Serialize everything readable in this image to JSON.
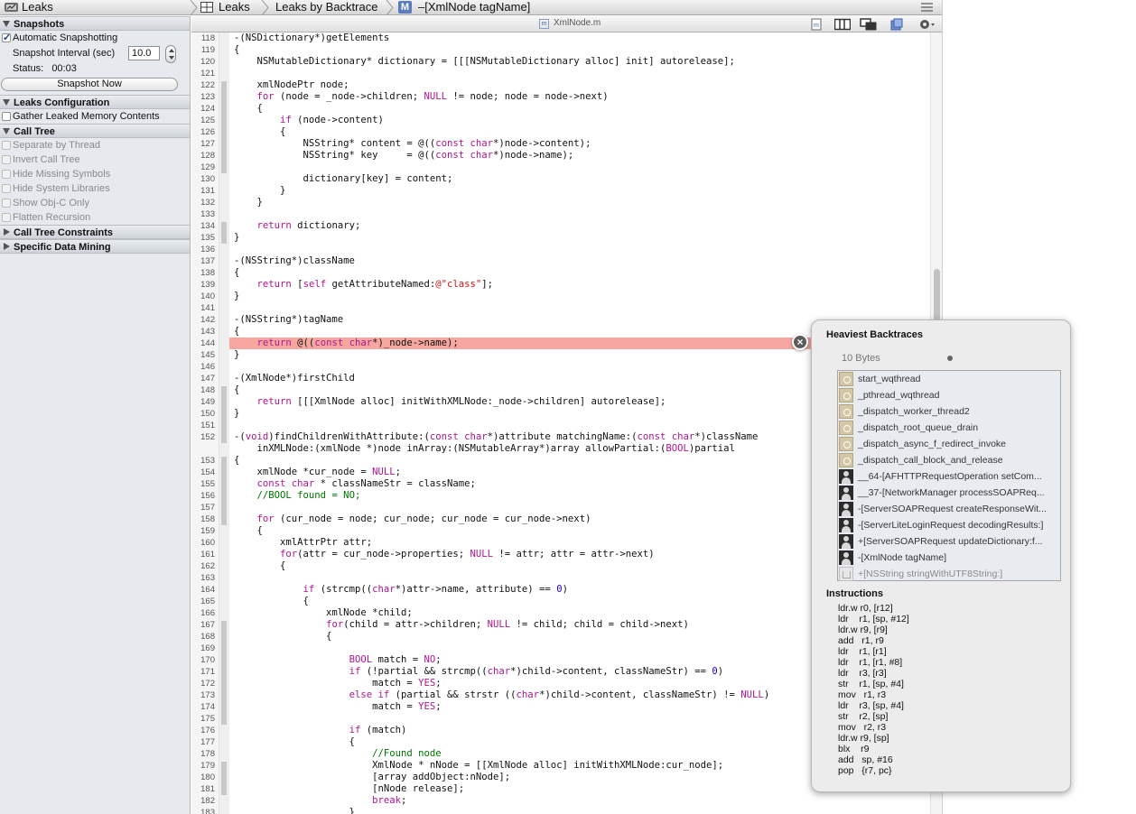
{
  "topbar": {
    "app_title": "Leaks",
    "crumb_1": "Leaks",
    "crumb_2": "Leaks by Backtrace",
    "crumb_3": "–[XmlNode tagName]",
    "badge": "M"
  },
  "left_panel": {
    "snapshots": {
      "header": "Snapshots",
      "auto_label": "Automatic Snapshotting",
      "interval_label": "Snapshot Interval (sec)",
      "interval_value": "10.0",
      "status_label": "Status:",
      "status_value": "00:03",
      "snapshot_button": "Snapshot Now"
    },
    "leaks_config": {
      "header": "Leaks Configuration",
      "gather_label": "Gather Leaked Memory Contents"
    },
    "call_tree": {
      "header": "Call Tree",
      "options": [
        "Separate by Thread",
        "Invert Call Tree",
        "Hide Missing Symbols",
        "Hide System Libraries",
        "Show Obj-C Only",
        "Flatten Recursion"
      ]
    },
    "constraints_header": "Call Tree Constraints",
    "data_mining_header": "Specific Data Mining"
  },
  "editor": {
    "file_name": "XmlNode.m",
    "file_badge": "m",
    "highlighted_line": 144,
    "lines": [
      {
        "n": "118",
        "html": "-(NSDictionary*)getElements"
      },
      {
        "n": "119",
        "html": "{"
      },
      {
        "n": "120",
        "html": "    NSMutableDictionary* dictionary = [[[NSMutableDictionary alloc] init] autorelease];"
      },
      {
        "n": "121",
        "html": ""
      },
      {
        "n": "122",
        "html": "    xmlNodePtr node;"
      },
      {
        "n": "123",
        "html": "    <span class=\"kw\">for</span> (node = _node->children; <span class=\"kw\">NULL</span> != node; node = node->next)"
      },
      {
        "n": "124",
        "html": "    {"
      },
      {
        "n": "125",
        "html": "        <span class=\"kw\">if</span> (node->content)"
      },
      {
        "n": "126",
        "html": "        {"
      },
      {
        "n": "127",
        "html": "            NSString* content = @((<span class=\"kw\">const char</span>*)node->content);"
      },
      {
        "n": "128",
        "html": "            NSString* key     = @((<span class=\"kw\">const char</span>*)node->name);"
      },
      {
        "n": "129",
        "html": ""
      },
      {
        "n": "130",
        "html": "            dictionary[key] = content;"
      },
      {
        "n": "131",
        "html": "        }"
      },
      {
        "n": "132",
        "html": "    }"
      },
      {
        "n": "133",
        "html": ""
      },
      {
        "n": "134",
        "html": "    <span class=\"kw\">return</span> dictionary;"
      },
      {
        "n": "135",
        "html": "}"
      },
      {
        "n": "136",
        "html": ""
      },
      {
        "n": "137",
        "html": "-(NSString*)className"
      },
      {
        "n": "138",
        "html": "{"
      },
      {
        "n": "139",
        "html": "    <span class=\"kw\">return</span> [<span class=\"kw\">self</span> getAttributeNamed:<span class=\"str\">@\"class\"</span>];"
      },
      {
        "n": "140",
        "html": "}"
      },
      {
        "n": "141",
        "html": ""
      },
      {
        "n": "142",
        "html": "-(NSString*)tagName"
      },
      {
        "n": "143",
        "html": "{"
      },
      {
        "n": "144",
        "html": "    <span class=\"kw\">return</span> @((<span class=\"kw\">const char</span>*)_node->name);"
      },
      {
        "n": "145",
        "html": "}"
      },
      {
        "n": "146",
        "html": ""
      },
      {
        "n": "147",
        "html": "-(XmlNode*)firstChild"
      },
      {
        "n": "148",
        "html": "{"
      },
      {
        "n": "149",
        "html": "    <span class=\"kw\">return</span> [[[XmlNode alloc] initWithXMLNode:_node->children] autorelease];"
      },
      {
        "n": "150",
        "html": "}"
      },
      {
        "n": "151",
        "html": ""
      },
      {
        "n": "152",
        "html": "-(<span class=\"kw\">void</span>)findChildrenWithAttribute:(<span class=\"kw\">const char</span>*)attribute matchingName:(<span class=\"kw\">const char</span>*)className"
      },
      {
        "n": "",
        "html": "    inXMLNode:(xmlNode *)node inArray:(NSMutableArray*)array allowPartial:(<span class=\"kw\">BOOL</span>)partial"
      },
      {
        "n": "153",
        "html": "{"
      },
      {
        "n": "154",
        "html": "    xmlNode *cur_node = <span class=\"kw\">NULL</span>;"
      },
      {
        "n": "155",
        "html": "    <span class=\"kw\">const char</span> * classNameStr = className;"
      },
      {
        "n": "156",
        "html": "    <span class=\"cm\">//BOOL found = NO;</span>"
      },
      {
        "n": "157",
        "html": ""
      },
      {
        "n": "158",
        "html": "    <span class=\"kw\">for</span> (cur_node = node; cur_node; cur_node = cur_node->next)"
      },
      {
        "n": "159",
        "html": "    {"
      },
      {
        "n": "160",
        "html": "        xmlAttrPtr attr;"
      },
      {
        "n": "161",
        "html": "        <span class=\"kw\">for</span>(attr = cur_node->properties; <span class=\"kw\">NULL</span> != attr; attr = attr->next)"
      },
      {
        "n": "162",
        "html": "        {"
      },
      {
        "n": "163",
        "html": ""
      },
      {
        "n": "164",
        "html": "            <span class=\"kw\">if</span> (strcmp((<span class=\"kw\">char</span>*)attr->name, attribute) == <span class=\"num-lit\">0</span>)"
      },
      {
        "n": "165",
        "html": "            {"
      },
      {
        "n": "166",
        "html": "                xmlNode *child;"
      },
      {
        "n": "167",
        "html": "                <span class=\"kw\">for</span>(child = attr->children; <span class=\"kw\">NULL</span> != child; child = child->next)"
      },
      {
        "n": "168",
        "html": "                {"
      },
      {
        "n": "169",
        "html": ""
      },
      {
        "n": "170",
        "html": "                    <span class=\"kw\">BOOL</span> match = <span class=\"kw\">NO</span>;"
      },
      {
        "n": "171",
        "html": "                    <span class=\"kw\">if</span> (!partial &amp;&amp; strcmp((<span class=\"kw\">char</span>*)child->content, classNameStr) == <span class=\"num-lit\">0</span>)"
      },
      {
        "n": "172",
        "html": "                        match = <span class=\"kw\">YES</span>;"
      },
      {
        "n": "173",
        "html": "                    <span class=\"kw\">else if</span> (partial &amp;&amp; strstr ((<span class=\"kw\">char</span>*)child->content, classNameStr) != <span class=\"kw\">NULL</span>)"
      },
      {
        "n": "174",
        "html": "                        match = <span class=\"kw\">YES</span>;"
      },
      {
        "n": "175",
        "html": ""
      },
      {
        "n": "176",
        "html": "                    <span class=\"kw\">if</span> (match)"
      },
      {
        "n": "177",
        "html": "                    {"
      },
      {
        "n": "178",
        "html": "                        <span class=\"cm\">//Found node</span>"
      },
      {
        "n": "179",
        "html": "                        XmlNode * nNode = [[XmlNode alloc] initWithXMLNode:cur_node];"
      },
      {
        "n": "180",
        "html": "                        [array addObject:nNode];"
      },
      {
        "n": "181",
        "html": "                        [nNode release];"
      },
      {
        "n": "182",
        "html": "                        <span class=\"kw\">break</span>;"
      },
      {
        "n": "183",
        "html": "                    }"
      }
    ]
  },
  "popover": {
    "title": "Heaviest Backtraces",
    "bytes": "10 Bytes",
    "backtraces": [
      {
        "icon": "gear",
        "label": "start_wqthread"
      },
      {
        "icon": "gear",
        "label": "_pthread_wqthread"
      },
      {
        "icon": "gear",
        "label": "_dispatch_worker_thread2"
      },
      {
        "icon": "gear",
        "label": "_dispatch_root_queue_drain"
      },
      {
        "icon": "gear",
        "label": "_dispatch_async_f_redirect_invoke"
      },
      {
        "icon": "gear",
        "label": "_dispatch_call_block_and_release"
      },
      {
        "icon": "user",
        "label": "__64-[AFHTTPRequestOperation setCom..."
      },
      {
        "icon": "user",
        "label": "__37-[NetworkManager processSOAPReq..."
      },
      {
        "icon": "user",
        "label": "-[ServerSOAPRequest createResponseWit..."
      },
      {
        "icon": "user",
        "label": "-[ServerLiteLoginRequest decodingResults:]"
      },
      {
        "icon": "user",
        "label": "+[ServerSOAPRequest updateDictionary:f..."
      },
      {
        "icon": "user",
        "label": "-[XmlNode tagName]"
      },
      {
        "icon": "cup",
        "label": "+[NSString stringWithUTF8String:]"
      }
    ],
    "instructions_title": "Instructions",
    "instructions": [
      "ldr.w r0, [r12]",
      "ldr    r1, [sp, #12]",
      "ldr.w r9, [r9]",
      "add   r1, r9",
      "ldr    r1, [r1]",
      "ldr    r1, [r1, #8]",
      "ldr    r3, [r3]",
      "str    r1, [sp, #4]",
      "mov   r1, r3",
      "ldr    r3, [sp, #4]",
      "str    r2, [sp]",
      "mov   r2, r3",
      "ldr.w r9, [sp]",
      "blx    r9",
      "add   sp, #16",
      "pop   {r7, pc}"
    ]
  }
}
